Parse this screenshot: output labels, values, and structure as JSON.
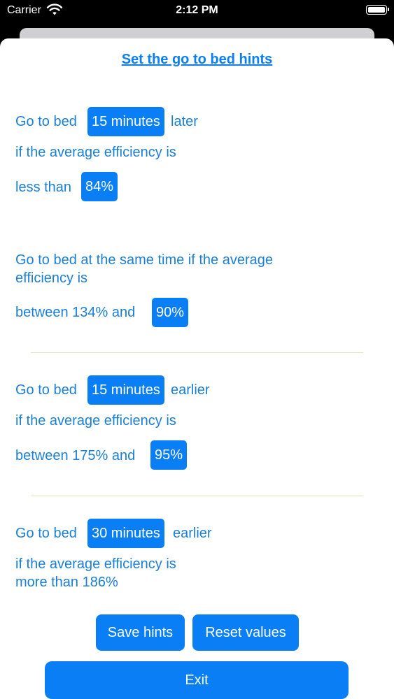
{
  "status_bar": {
    "carrier": "Carrier",
    "time": "2:12 PM"
  },
  "title": "Set the go to bed hints",
  "hint_later": {
    "prefix": "Go to bed",
    "amount": "15 minutes",
    "suffix": "later",
    "line2": "if the average efficiency is",
    "line3_prefix": "less than",
    "threshold": "84%"
  },
  "hint_same": {
    "line1": "Go to bed at the same time if the average",
    "line2": "efficiency is",
    "line3_prefix": "between 134% and",
    "threshold": "90%"
  },
  "hint_earlier_1": {
    "prefix": "Go to bed",
    "amount": "15 minutes",
    "suffix": "earlier",
    "line2": "if the average efficiency is",
    "line3_prefix": "between 175% and",
    "threshold": "95%"
  },
  "hint_earlier_2": {
    "prefix": "Go to bed",
    "amount": "30 minutes",
    "suffix": "earlier",
    "line2": "if the average efficiency is",
    "line3": "more than 186%"
  },
  "buttons": {
    "save": "Save hints",
    "reset": "Reset values",
    "exit": "Exit"
  },
  "colors": {
    "accent": "#0a7ff5",
    "text_blue": "#1c7fd6",
    "separator": "#e7dfbf"
  }
}
